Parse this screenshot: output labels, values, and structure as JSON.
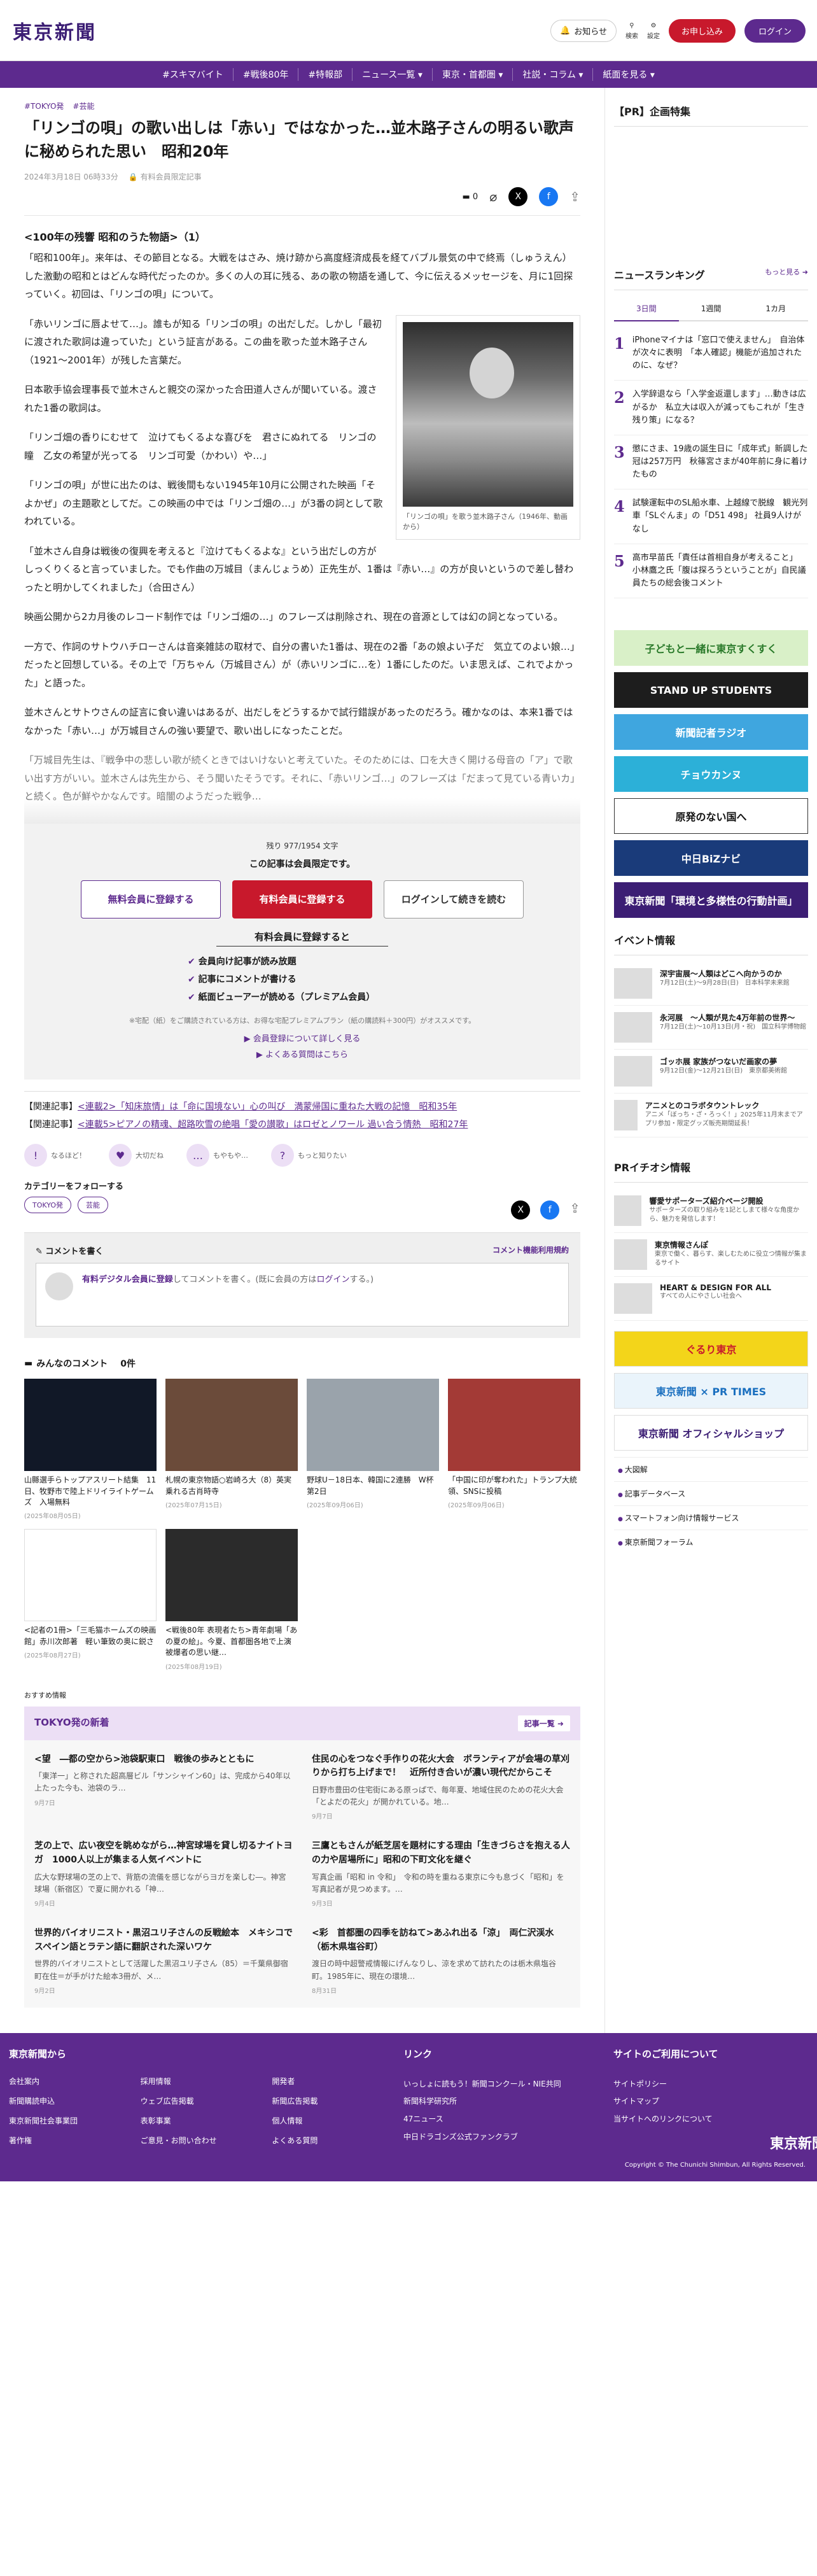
{
  "header": {
    "logo": "東京新聞",
    "notify": "お知らせ",
    "search": "検索",
    "settings": "設定",
    "subscribe": "お申し込み",
    "login": "ログイン"
  },
  "nav": [
    "#スキマバイト",
    "#戦後80年",
    "#特報部",
    "ニュース一覧 ▾",
    "東京・首都圏 ▾",
    "社説・コラム ▾",
    "紙面を見る ▾"
  ],
  "article": {
    "tags": [
      "#TOKYO発",
      "#芸能"
    ],
    "title": "「リンゴの唄」の歌い出しは「赤い」ではなかった…並木路子さんの明るい歌声に秘められた思い　昭和20年",
    "date": "2024年3月18日 06時33分",
    "badge": "有料会員限定記事",
    "comments": "0",
    "subtitle": "<100年の残響 昭和のうた物語>（1）",
    "paras": [
      "「昭和100年」。来年は、その節目となる。大戦をはさみ、焼け跡から高度経済成長を経てバブル景気の中で終焉（しゅうえん）した激動の昭和とはどんな時代だったのか。多くの人の耳に残る、あの歌の物語を通して、今に伝えるメッセージを、月に1回探っていく。初回は、「リンゴの唄」について。",
      "「赤いリンゴに唇よせて…」。誰もが知る「リンゴの唄」の出だしだ。しかし「最初に渡された歌詞は違っていた」という証言がある。この曲を歌った並木路子さん（1921〜2001年）が残した言葉だ。",
      "日本歌手協会理事長で並木さんと親交の深かった合田道人さんが聞いている。渡された1番の歌詞は。",
      "「リンゴ畑の香りにむせて　泣けてもくるよな喜びを　君さにぬれてる　リンゴの瞳　乙女の希望が光ってる　リンゴ可愛（かわい）や…」",
      "「リンゴの唄」が世に出たのは、戦後間もない1945年10月に公開された映画「そよかぜ」の主題歌としてだ。この映画の中では「リンゴ畑の…」が3番の詞として歌われている。",
      "「並木さん自身は戦後の復興を考えると『泣けてもくるよな』という出だしの方がしっくりくると言っていました。でも作曲の万城目（まんじょうめ）正先生が、1番は『赤い…』の方が良いというので差し替わったと明かしてくれました」（合田さん）",
      "映画公開から2カ月後のレコード制作では「リンゴ畑の…」のフレーズは削除され、現在の音源としては幻の詞となっている。",
      "一方で、作詞のサトウハチローさんは音楽雑誌の取材で、自分の書いた1番は、現在の2番「あの娘よい子だ　気立てのよい娘…」だったと回想している。その上で「万ちゃん（万城目さん）が（赤いリンゴに…を）1番にしたのだ。いま思えば、これでよかった」と語った。",
      "並木さんとサトウさんの証言に食い違いはあるが、出だしをどうするかで試行錯誤があったのだろう。確かなのは、本来1番ではなかった「赤い…」が万城目さんの強い要望で、歌い出しになったことだ。",
      "「万城目先生は、『戦争中の悲しい歌が続くときではいけないと考えていた。そのためには、口を大きく開ける母音の「ア」で歌い出す方がいい。並木さんは先生から、そう聞いたそうです。それに、「赤いリンゴ…」のフレーズは「だまって見ている青いカ」と続く。色が鮮やかなんです。暗闇のようだった戦争…"
    ],
    "caption": "「リンゴの唄」を歌う並木路子さん（1946年、動画から）"
  },
  "paywall": {
    "remaining": "残り 977/1954 文字",
    "notice": "この記事は会員限定です。",
    "btn_free": "無料会員に登録する",
    "btn_paid": "有料会員に登録する",
    "btn_login": "ログインして続きを読む",
    "heading": "有料会員に登録すると",
    "perks": [
      "会員向け記事が読み放題",
      "記事にコメントが書ける",
      "紙面ビューアーが読める（プレミアム会員）"
    ],
    "note": "※宅配（紙）をご購読されている方は、お得な宅配プレミアムプラン（紙の購読料＋300円）がオススメです。",
    "link1": "▶ 会員登録について詳しく見る",
    "link2": "▶ よくある質問はこちら"
  },
  "related": [
    {
      "label": "【関連記事】",
      "text": "<連載2>「知床旅情」は「命に国境ない」心の叫び　満蒙帰国に重ねた大戦の記憶　昭和35年"
    },
    {
      "label": "【関連記事】",
      "text": "<連載5>ピアノの精魂、超路吹雪の絶唱「愛の讃歌」はロゼとノワール 過い合う情熱　昭和27年"
    }
  ],
  "reactions": [
    {
      "icon": "!",
      "label": "なるほど！"
    },
    {
      "icon": "♥",
      "label": "大切だね"
    },
    {
      "icon": "…",
      "label": "もやもや…"
    },
    {
      "icon": "?",
      "label": "もっと知りたい"
    }
  ],
  "follow": {
    "title": "カテゴリーをフォローする",
    "tags": [
      "TOKYO発",
      "芸能"
    ]
  },
  "comment": {
    "title": "コメントを書く",
    "policy": "コメント機能利用規約",
    "link": "有料デジタル会員に登録",
    "text": "してコメントを書く。(既に会員の方は",
    "login": "ログイン",
    "end": "する。)"
  },
  "member_comments": {
    "title": "みんなのコメント",
    "count": "0件"
  },
  "cards": [
    {
      "t": "山縣選手らトップアスリート結集　11日、牧野市で陸上ドリイライトゲームズ　入場無料",
      "d": "(2025年08月05日)",
      "c": "#111827"
    },
    {
      "t": "札幌の東京物語○岩崎ろ大（8）英実乗れる古肖時寺",
      "d": "(2025年07月15日)",
      "c": "#6b4b3a"
    },
    {
      "t": "野球U－18日本、韓国に2連勝　W杯第2日",
      "d": "(2025年09月06日)",
      "c": "#9aa3ab"
    },
    {
      "t": "「中国に印が奪われた」トランプ大統領、SNSに投稿",
      "d": "(2025年09月06日)",
      "c": "#a33a36"
    },
    {
      "t": "<記者の1冊>「三毛猫ホームズの映画館」赤川次郎著　軽い筆致の奥に鋭さ",
      "d": "(2025年08月27日)",
      "c": "#ffffff"
    },
    {
      "t": "<戦後80年 表現者たち>青年劇場「あの夏の絵」。今夏、首都圏各地で上演　被爆者の思い継…",
      "d": "(2025年08月19日)",
      "c": "#2b2b2b"
    }
  ],
  "recommend": "おすすめ情報",
  "tokyo_news": {
    "title": "TOKYO発の新着",
    "more": "記事一覧 ➜",
    "items": [
      {
        "t": "<望　―都の空から>池袋駅東口　戦後の歩みとともに",
        "s": "「東洋一」と称された超高層ビル「サンシャイン60」は、完成から40年以上たった今も、池袋のラ…",
        "d": "9月7日"
      },
      {
        "t": "住民の心をつなぐ手作りの花火大会　ボランティアが会場の草刈りから打ち上げまで！　近所付き合いが濃い現代だからこそ",
        "s": "日野市豊田の住宅街にある原っぱで、毎年夏、地域住民のための花火大会「とよだの花火」が開かれている。地…",
        "d": "9月7日"
      },
      {
        "t": "芝の上で、広い夜空を眺めながら…神宮球場を貸し切るナイトヨガ　1000人以上が集まる人気イベントに",
        "s": "広大な野球場の芝の上で、背筋の流儀を感じながらヨガを楽しむ―。神宮球場（新宿区）で夏に開かれる「神…",
        "d": "9月4日"
      },
      {
        "t": "三鷹ともさんが紙芝居を題材にする理由「生きづらさを抱える人の力や居場所に」昭和の下町文化を継ぐ",
        "s": "写真企画「昭和 in 令和」　令和の時を重ねる東京に今も息づく「昭和」を写真記者が見つめます。…",
        "d": "9月3日"
      },
      {
        "t": "世界的バイオリニスト・黒沼ユリ子さんの反戦絵本　メキシコでスペイン語とラテン語に翻訳された深いワケ",
        "s": "世界的バイオリニストとして活躍した黒沼ユリ子さん（85）＝千葉県御宿町在住＝が手がけた絵本3冊が、メ…",
        "d": "9月2日"
      },
      {
        "t": "<彩　首都圏の四季を訪ねて>あふれ出る「涼」　両仁沢渓水（栃木県塩谷町）",
        "s": "渡日の時中超警戒情報にげんなりし、涼を求めて訪れたのは栃木県塩谷町。1985年に、現在の環境…",
        "d": "8月31日"
      }
    ]
  },
  "sidebar": {
    "pr_title": "【PR】企画特集",
    "rank_title": "ニュースランキング",
    "rank_more": "もっと見る ➜",
    "rank_tabs": [
      "3日間",
      "1週間",
      "1カ月"
    ],
    "ranking": [
      "iPhoneマイナは「窓口で使えません」　自治体が次々に表明　「本人確認」機能が追加されたのに、なぜ？",
      "入学辞退なら「入学金返還します」…動きは広がるか　私立大は収入が減ってもこれが「生き残り策」になる？",
      "懲にさま、19歳の誕生日に「成年式」新調した冠は257万円　秋篠宮さまが40年前に身に着けたもの",
      "試験運転中のSL船水車、上越線で脱線　観光列車「SLぐんま」の「D51 498」 社員9人けがなし",
      "高市早苗氏「責任は首相自身が考えること」　小林鷹之氏「腹は探ろうということが」自民議員たちの総会後コメント"
    ],
    "banners": [
      {
        "t": "子どもと一緒に東京すくすく",
        "c": "#d9f0c8",
        "fc": "#2a7a2a"
      },
      {
        "t": "STAND UP STUDENTS",
        "c": "#1d1d1d",
        "fc": "#ffffff"
      },
      {
        "t": "新聞記者ラジオ",
        "c": "#3fa6df",
        "fc": "#ffffff"
      },
      {
        "t": "チョウカンヌ",
        "c": "#2cb0d8",
        "fc": "#ffffff"
      },
      {
        "t": "原発のない国へ",
        "c": "#ffffff",
        "fc": "#111111"
      },
      {
        "t": "中日BiZナビ",
        "c": "#1a3b7a",
        "fc": "#ffffff"
      },
      {
        "t": "東京新聞「環境と多様性の行動計画」",
        "c": "#3c1e74",
        "fc": "#ffffff"
      }
    ],
    "event_title": "イベント情報",
    "events": [
      {
        "t": "深宇宙展〜人類はどこへ向かうのか",
        "s": "7月12日(土)〜9月28日(日)　日本科学未来館"
      },
      {
        "t": "永河展　〜人類が見た4万年前の世界〜",
        "s": "7月12日(土)〜10月13日(月・祝)　国立科学博物館"
      },
      {
        "t": "ゴッホ展 家族がつないだ画家の夢",
        "s": "9月12日(金)〜12月21日(日)　東京都美術館"
      },
      {
        "t": "アニメとのコラボタウントレック",
        "s": "アニメ「ぼっち・ざ・ろっく！」2025年11月末までアプリ参加・限定グッズ販売期間延長！"
      }
    ],
    "pr_event_title": "PRイチオシ情報",
    "pr_events": [
      {
        "t": "響愛サポーターズ紹介ページ開設",
        "s": "サポーターズの取り組みを1記としまて様々な角度から、魅力を発信します！"
      },
      {
        "t": "東京情報さんぽ",
        "s": "東京で働く、暮らす、楽しむために役立つ情報が集まるサイト"
      },
      {
        "t": "HEART & DESIGN FOR ALL",
        "s": "すべての人にやさしい社会へ"
      }
    ],
    "promo_banners": [
      {
        "t": "ぐるり東京",
        "c": "#f3d51a",
        "fc": "#c8192c"
      },
      {
        "t": "東京新聞 × PR TIMES",
        "c": "#eaf4fb",
        "fc": "#1a6fbf"
      },
      {
        "t": "東京新聞 オフィシャルショップ",
        "c": "#ffffff",
        "fc": "#3c1e74"
      }
    ],
    "links": [
      "大図解",
      "記事データベース",
      "スマートフォン向け情報サービス",
      "東京新聞フォーラム"
    ]
  },
  "footer": {
    "col1_title": "東京新聞から",
    "col1": [
      "会社案内",
      "採用情報",
      "開発者",
      "新聞購読申込",
      "ウェブ広告掲載",
      "新聞広告掲載",
      "東京新聞社会事業団",
      "表彰事業",
      "個人情報",
      "著作権",
      "ご意見・お問い合わせ",
      "よくある質問"
    ],
    "col2_title": "リンク",
    "col2": [
      "いっしょに読もう！新聞コンクール・NIE共同",
      "新聞科学研究所",
      "47ニュース",
      "中日ドラゴンズ公式ファンクラブ"
    ],
    "col3_title": "サイトのご利用について",
    "col3": [
      "サイトポリシー",
      "サイトマップ",
      "当サイトへのリンクについて"
    ],
    "logo": "東京新聞",
    "copyright": "Copyright © The Chunichi Shimbun, All Rights Reserved."
  }
}
